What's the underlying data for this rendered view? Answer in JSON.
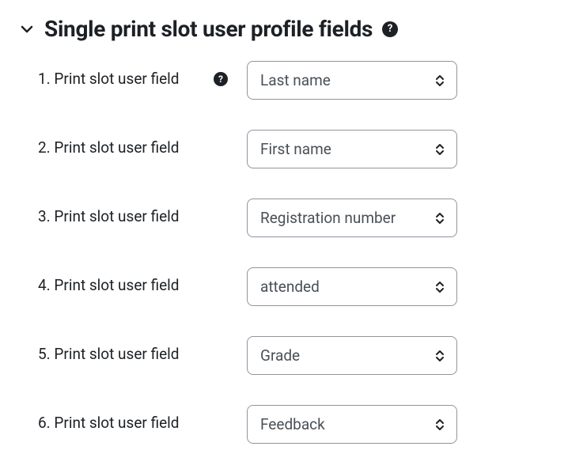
{
  "section": {
    "title": "Single print slot user profile fields"
  },
  "rows": [
    {
      "label": "1. Print slot user field",
      "value": "Last name",
      "hasHelp": true
    },
    {
      "label": "2. Print slot user field",
      "value": "First name",
      "hasHelp": false
    },
    {
      "label": "3. Print slot user field",
      "value": "Registration number",
      "hasHelp": false
    },
    {
      "label": "4. Print slot user field",
      "value": "attended",
      "hasHelp": false
    },
    {
      "label": "5. Print slot user field",
      "value": "Grade",
      "hasHelp": false
    },
    {
      "label": "6. Print slot user field",
      "value": "Feedback",
      "hasHelp": false
    }
  ]
}
